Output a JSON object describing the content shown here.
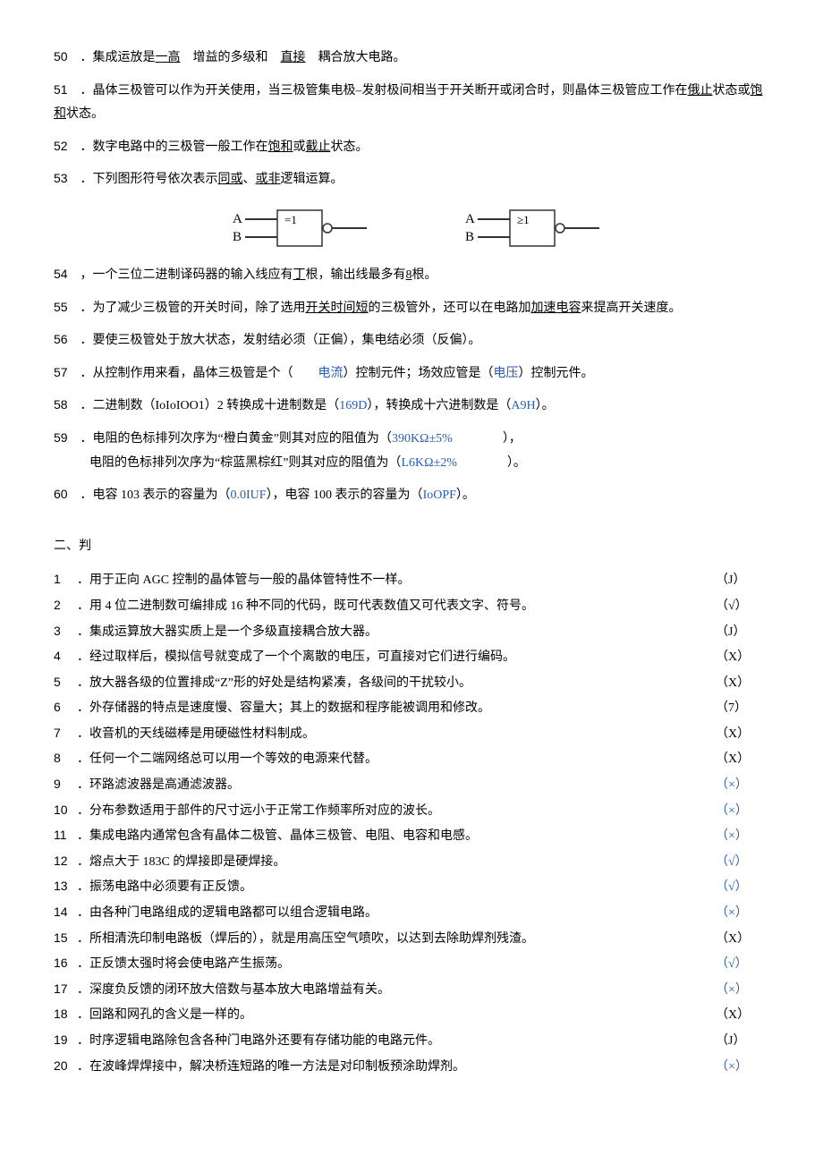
{
  "fill": {
    "q50": {
      "num": "50",
      "pre": "．集成运放是",
      "a1": "一高",
      "mid1": " 增益的多级和 ",
      "a2": "直接",
      "mid2": " 耦合放大电路。"
    },
    "q51": {
      "num": "51",
      "text1": "．晶体三极管可以作为开关使用，当三极管集电极–发射极间相当于开关断开或闭合时，则晶体三极管应工作在",
      "a1": "俄止",
      "text2": "状态或",
      "a2": "饱和",
      "text3": "状态。"
    },
    "q52": {
      "num": "52",
      "pre": "．数字电路中的三极管一般工作在",
      "a1": "饱和",
      "mid": "或",
      "a2": "截止",
      "post": "状态。"
    },
    "q53": {
      "num": "53",
      "pre": "．下列图形符号依次表示",
      "a1": "同或",
      "mid": "、",
      "a2": "或非",
      "blank": "           ",
      "post": "逻辑运算。"
    },
    "q54": {
      "num": "54",
      "pre": "，一个三位二进制译码器的输入线应有",
      "a1": "丁",
      "mid": "根，输出线最多有",
      "a2": "8",
      "post": "根。"
    },
    "q55": {
      "num": "55",
      "pre": "．为了减少三极管的开关时间，除了选用",
      "a1": "开关时间短",
      "mid": "的三极管外，还可以在电路加",
      "a2": "加速电容",
      "post": "来提高开关速度。"
    },
    "q56": {
      "num": "56",
      "text": "．要使三极管处于放大状态，发射结必须（正偏），集电结必须（反偏）。"
    },
    "q57": {
      "num": "57",
      "pre": "．从控制作用来看，晶体三极管是个（  ",
      "a1": "电流",
      "mid": "）控制元件；场效应管是（",
      "a2": "电压",
      "post": "）控制元件。"
    },
    "q58": {
      "num": "58",
      "pre": "．二进制数（IoIoIOO1）2 转换成十进制数是（",
      "a1": "169D",
      "mid": "），转换成十六进制数是（",
      "a2": "A9H",
      "post": "）。"
    },
    "q59": {
      "num": "59",
      "pre": "．电阻的色标排列次序为“橙白黄金”则其对应的阻值为（",
      "a1": "390KΩ±5%",
      "post1": "    ），",
      "line2pre": "电阻的色标排列次序为“棕蓝黑棕红”则其对应的阻值为（",
      "a2": "L6KΩ±2%",
      "post2": "    ）。"
    },
    "q60": {
      "num": "60",
      "pre": "．电容 103 表示的容量为（",
      "a1": "0.0IUF",
      "mid": "），电容 100 表示的容量为（",
      "a2": "IoOPF",
      "post": "）。"
    }
  },
  "fig": {
    "sym1": "=1",
    "sym2": "≥1",
    "A": "A",
    "B": "B"
  },
  "section2": "二、判",
  "tf": [
    {
      "n": "1",
      "t": "．用于正向 AGC 控制的晶体管与一般的晶体管特性不一样。",
      "a": "（J）",
      "cls": ""
    },
    {
      "n": "2",
      "t": "．用 4 位二进制数可编排成 16 种不同的代码，既可代表数值又可代表文字、符号。",
      "a": "（√）",
      "cls": ""
    },
    {
      "n": "3",
      "t": "．集成运算放大器实质上是一个多级直接耦合放大器。",
      "a": "（J）",
      "cls": ""
    },
    {
      "n": "4",
      "t": "．经过取样后，模拟信号就变成了一个个离散的电压，可直接对它们进行编码。",
      "a": "（X）",
      "cls": ""
    },
    {
      "n": "5",
      "t": "．放大器各级的位置排成“Z”形的好处是结构紧凑，各级间的干扰较小。",
      "a": "（X）",
      "cls": ""
    },
    {
      "n": "6",
      "t": "．外存储器的特点是速度慢、容量大；其上的数据和程序能被调用和修改。",
      "a": "（7）",
      "cls": ""
    },
    {
      "n": "7",
      "t": "．收音机的天线磁棒是用硬磁性材料制成。",
      "a": "（X）",
      "cls": ""
    },
    {
      "n": "8",
      "t": "．任何一个二端网络总可以用一个等效的电源来代替。",
      "a": "（X）",
      "cls": ""
    },
    {
      "n": "9",
      "t": "．环路滤波器是高通滤波器。",
      "a": "（×）",
      "cls": "blue"
    },
    {
      "n": "10",
      "t": "．分布参数适用于部件的尺寸远小于正常工作频率所对应的波长。",
      "a": "（×）",
      "cls": "blue"
    },
    {
      "n": "11",
      "t": "．集成电路内通常包含有晶体二极管、晶体三极管、电阻、电容和电感。",
      "a": "（×）",
      "cls": "blue"
    },
    {
      "n": "12",
      "t": "．熔点大于 183C 的焊接即是硬焊接。",
      "a": "（√）",
      "cls": "blue"
    },
    {
      "n": "13",
      "t": "．振荡电路中必须要有正反馈。",
      "a": "（√）",
      "cls": "blue"
    },
    {
      "n": "14",
      "t": "．由各种门电路组成的逻辑电路都可以组合逻辑电路。",
      "a": "（×）",
      "cls": "blue"
    },
    {
      "n": "15",
      "t": "．所相清洗印制电路板（焊后的），就是用高压空气喷吹，以达到去除助焊剂残渣。",
      "a": "（X）",
      "cls": ""
    },
    {
      "n": "16",
      "t": "．正反馈太强时将会使电路产生振荡。",
      "a": "（√）",
      "cls": "blue"
    },
    {
      "n": "17",
      "t": "．深度负反馈的闭环放大倍数与基本放大电路增益有关。",
      "a": "（×）",
      "cls": "blue"
    },
    {
      "n": "18",
      "t": "．回路和网孔的含义是一样的。",
      "a": "（X）",
      "cls": ""
    },
    {
      "n": "19",
      "t": "．时序逻辑电路除包含各种门电路外还要有存储功能的电路元件。",
      "a": "（J）",
      "cls": ""
    },
    {
      "n": "20",
      "t": "．在波峰焊焊接中，解决桥连短路的唯一方法是对印制板预涂助焊剂。",
      "a": "（×）",
      "cls": "blue"
    }
  ]
}
